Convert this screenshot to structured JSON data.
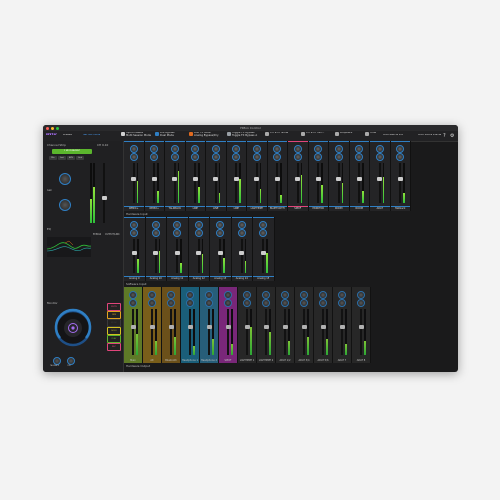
{
  "window": {
    "title": "HMon Control"
  },
  "toolbar": {
    "presets_label": "Presets",
    "preset_value": "Set Mix Mode",
    "items": [
      {
        "label": "Input Presets\nMulti Session Mode",
        "color": "#d2d2d2"
      },
      {
        "label": "DSI Bypass\nDual Mode",
        "color": "#2f7fc4"
      },
      {
        "label": "Anti FX Mute\nAnalog Bypass/Dry",
        "color": "#e06a1f"
      },
      {
        "label": "Toggle FX Bypass\nToggle FX Bypass A",
        "color": "#9aa0a6"
      },
      {
        "label": "CH 9-17 None",
        "color": "#aaaaaa"
      },
      {
        "label": "CH 9-17 Mix...",
        "color": "#aaaaaa"
      },
      {
        "label": "Loopback",
        "color": "#aaaaaa"
      },
      {
        "label": "Tone",
        "color": "#aaaaaa"
      }
    ],
    "right_text_1": "Clock Rate  48 kHz",
    "right_text_2": "Clock Source  Internal",
    "help_icon": "help-icon",
    "settings_icon": "gear-icon"
  },
  "left_panel": {
    "channel_strip_title": "Channel Strip",
    "channel_strip_right": "CH 9-10",
    "mic_button": "1 MIC/LINE/INST",
    "small_buttons": [
      "Mic",
      "Inst",
      "48V",
      "Link"
    ],
    "gain_label": "Gain",
    "eq_label": "EQ",
    "bypass_label": "BYPASS",
    "eq_right": "OUTPUT/LINK",
    "monitor_title": "Monitor",
    "monitor_buttons": [
      "MUTE",
      "DIM",
      "MONO",
      "SOLO",
      "PLAY",
      "REC"
    ],
    "bottom_knob_labels": [
      "TALKBACK",
      "CUE"
    ],
    "center_icon": "monitor-speaker-icon"
  },
  "sections": {
    "hardware_input": "Hardware Input",
    "software_input": "Software Input",
    "hardware_output": "Hardware Output"
  },
  "top_strips": [
    {
      "label": "REMIX+",
      "color": "#2f7fc4"
    },
    {
      "label": "REMIX+",
      "color": "#2f7fc4"
    },
    {
      "label": "TALKBACK",
      "color": "#2f7fc4"
    },
    {
      "label": "LINE",
      "color": "#2f7fc4"
    },
    {
      "label": "LINE",
      "color": "#2f7fc4"
    },
    {
      "label": "LINE",
      "color": "#2f7fc4"
    },
    {
      "label": "LIGHTPIPE",
      "color": "#2f7fc4"
    },
    {
      "label": "BLUETOOTH",
      "color": "#2f7fc4"
    },
    {
      "label": "SPDIF",
      "color": "#e0457b"
    },
    {
      "label": "MONITOR",
      "color": "#2f7fc4"
    },
    {
      "label": "ROOM",
      "color": "#2f7fc4"
    },
    {
      "label": "ROOM",
      "color": "#2f7fc4"
    },
    {
      "label": "ADAT",
      "color": "#2f7fc4"
    },
    {
      "label": "Talkback",
      "color": "#2f7fc4"
    }
  ],
  "mid_strips": [
    {
      "label": "Analog 9",
      "color": "#2f7fc4"
    },
    {
      "label": "Analog 10",
      "color": "#2f7fc4"
    },
    {
      "label": "Analog 11",
      "color": "#2f7fc4"
    },
    {
      "label": "Analog 12",
      "color": "#2f7fc4"
    },
    {
      "label": "Analog 13",
      "color": "#2f7fc4"
    },
    {
      "label": "Analog 14",
      "color": "#2f7fc4"
    },
    {
      "label": "Analog 15",
      "color": "#2f7fc4"
    }
  ],
  "bottom_strips": [
    {
      "label": "Main",
      "color": "#6a8a2a"
    },
    {
      "label": "Alt",
      "color": "#8a6a1a"
    },
    {
      "label": "Bluetooth",
      "color": "#7a5a1a"
    },
    {
      "label": "Headphone 1",
      "color": "#1a6a8a"
    },
    {
      "label": "Headphone 2",
      "color": "#2a6a8a"
    },
    {
      "label": "SPDIF",
      "color": "#8a2a8a"
    },
    {
      "label": "LIGHTPIPE 1",
      "color": "#2a2a2a"
    },
    {
      "label": "LIGHTPIPE 2",
      "color": "#2a2a2a"
    },
    {
      "label": "ADAT 1/2",
      "color": "#2a2a2a"
    },
    {
      "label": "ADAT 3/4",
      "color": "#2a2a2a"
    },
    {
      "label": "ADAT 5/6",
      "color": "#2a2a2a"
    },
    {
      "label": "ADAT 7",
      "color": "#2a2a2a"
    },
    {
      "label": "ADAT 8",
      "color": "#2a2a2a"
    }
  ],
  "colors": {
    "accent": "#2f7fc4",
    "meter_green": "#2fc13a",
    "button_green": "#5bb52d",
    "window_bg": "#1a1a1b"
  }
}
